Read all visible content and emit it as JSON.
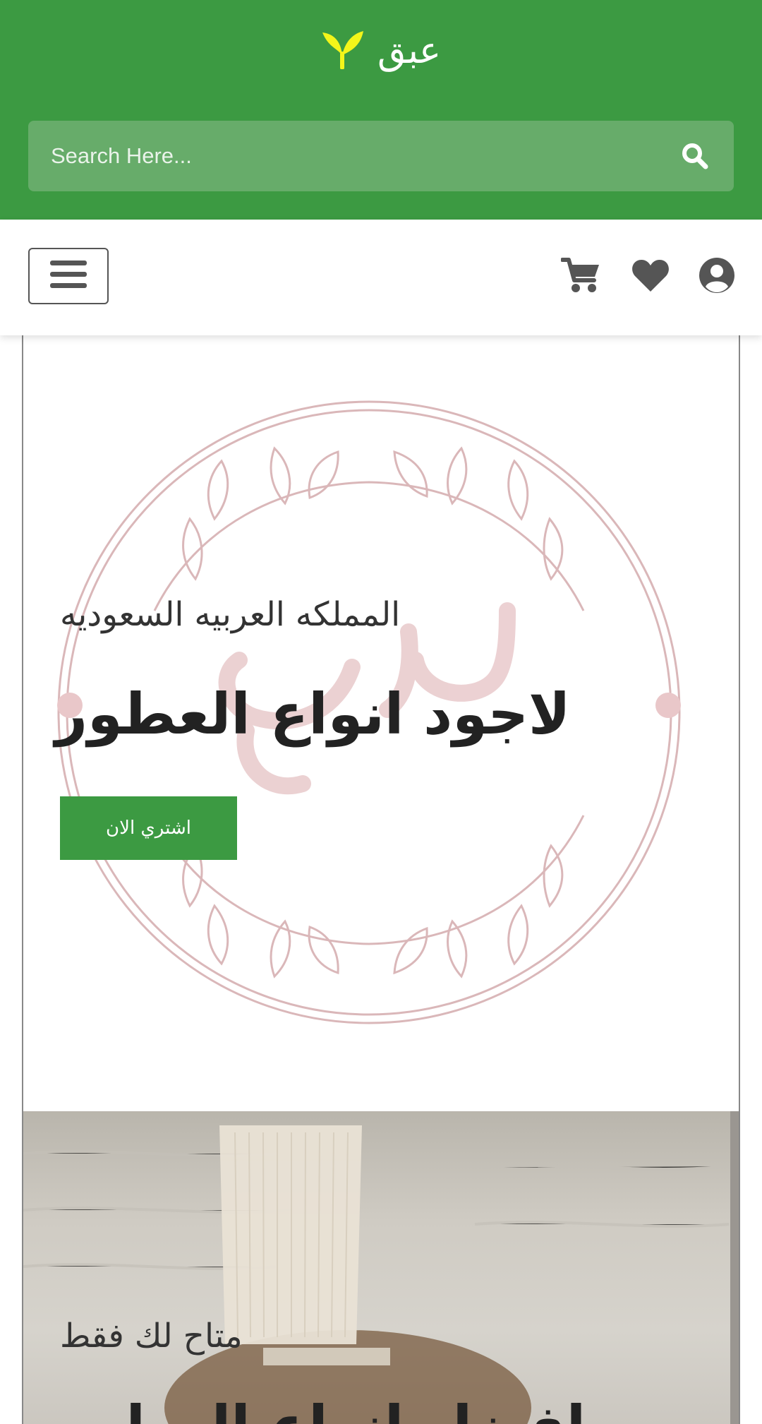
{
  "header": {
    "logo_text": "عبق",
    "search": {
      "placeholder": "Search Here..."
    }
  },
  "navbar": {
    "icons": [
      "menu-icon",
      "cart-icon",
      "heart-icon",
      "user-icon"
    ]
  },
  "slides": [
    {
      "subtitle": "المملكه العربيه السعوديه",
      "title": "لاجود انواع العطور",
      "button_label": "اشتري الان"
    },
    {
      "subtitle": "متاح لك فقط",
      "title": "افضل انواع العطور"
    }
  ],
  "colors": {
    "brand_green": "#3c9a42",
    "search_bg": "#67ac6a",
    "logo_leaf": "#f3f51a",
    "icon_gray": "#555555",
    "emblem_pink": "#dab7b9"
  }
}
